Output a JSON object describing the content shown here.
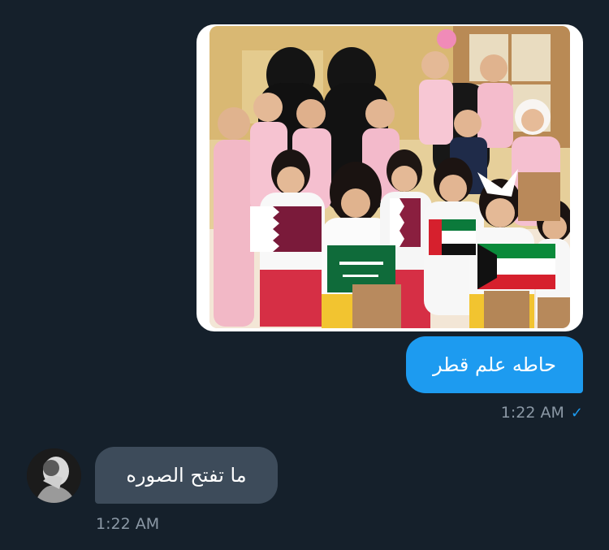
{
  "messages": {
    "outgoing": {
      "text": "حاطه علم قطر",
      "time": "1:22 AM",
      "status_icon": "check-icon"
    },
    "incoming": {
      "text": "ما تفتح الصوره",
      "time": "1:22 AM",
      "avatar_icon": "avatar"
    }
  },
  "colors": {
    "background": "#15202b",
    "outgoing_bubble": "#1d9bf0",
    "incoming_bubble": "#3d4b5a",
    "timestamp": "#8b98a5"
  },
  "photo": {
    "flag_labels": [
      "السعودية",
      "الكويت"
    ]
  }
}
